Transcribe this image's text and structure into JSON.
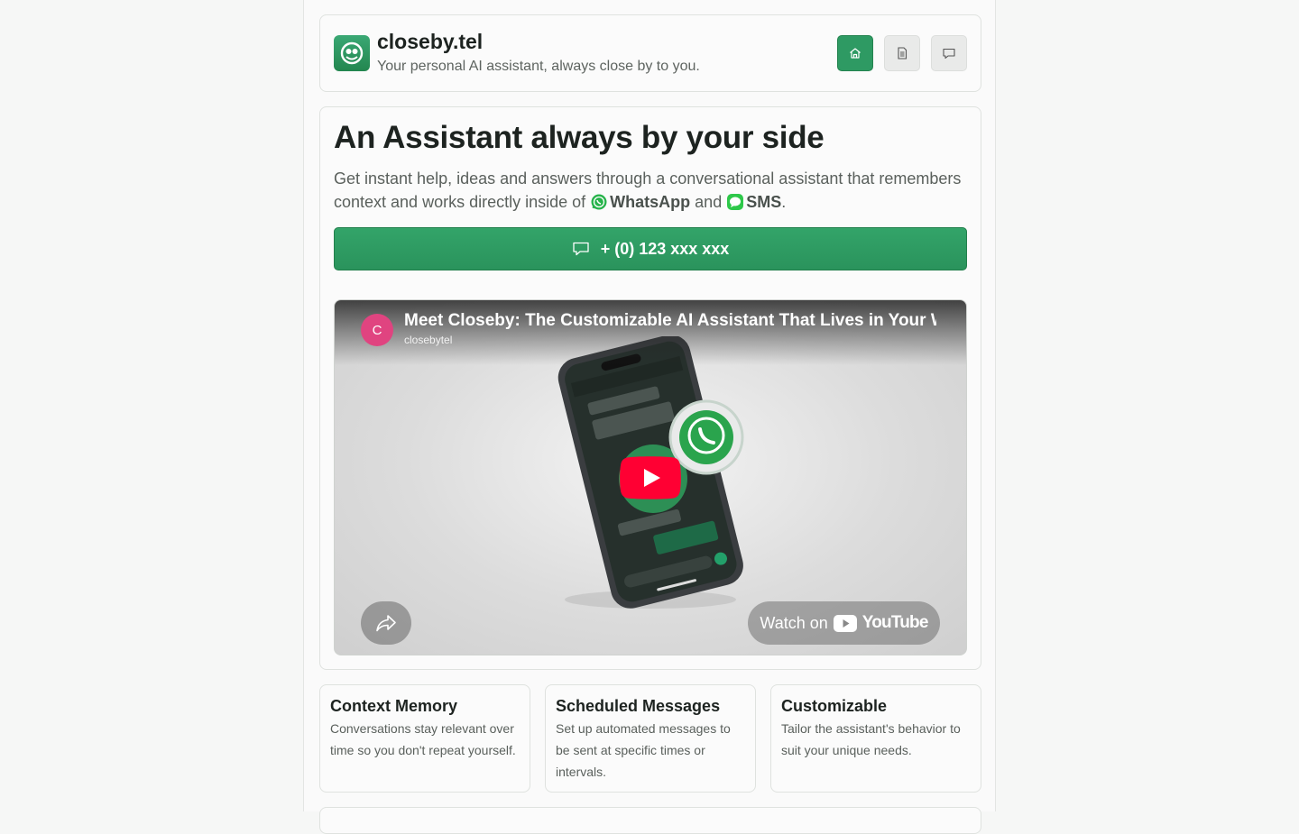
{
  "header": {
    "brand_title": "closeby.tel",
    "tagline": "Your personal AI assistant, always close by to you.",
    "nav": [
      {
        "name": "home",
        "icon": "home-icon",
        "active": true
      },
      {
        "name": "docs",
        "icon": "document-icon",
        "active": false
      },
      {
        "name": "chat",
        "icon": "chat-icon",
        "active": false
      }
    ]
  },
  "hero": {
    "title": "An Assistant always by your side",
    "description_prefix": "Get instant help, ideas and answers through a conversational assistant that remembers context and works directly inside of",
    "platform_whatsapp": "WhatsApp",
    "conjunction": "and",
    "platform_sms": "SMS",
    "period": ".",
    "cta_label": "+ (0) 123 xxx xxx"
  },
  "video": {
    "channel_initial": "C",
    "title": "Meet Closeby: The Customizable AI Assistant That Lives in Your WhatsApp",
    "channel": "closebytel",
    "watch_on": "Watch on",
    "youtube_word": "YouTube"
  },
  "features": [
    {
      "title": "Context Memory",
      "text": "Conversations stay relevant over time so you don't repeat yourself."
    },
    {
      "title": "Scheduled Messages",
      "text": "Set up automated messages to be sent at specific times or intervals."
    },
    {
      "title": "Customizable",
      "text": "Tailor the assistant's behavior to suit your unique needs."
    }
  ],
  "colors": {
    "accent": "#2e9a63",
    "text": "#1d2320",
    "muted": "#5a605c",
    "youtube_red": "#ff0033"
  }
}
